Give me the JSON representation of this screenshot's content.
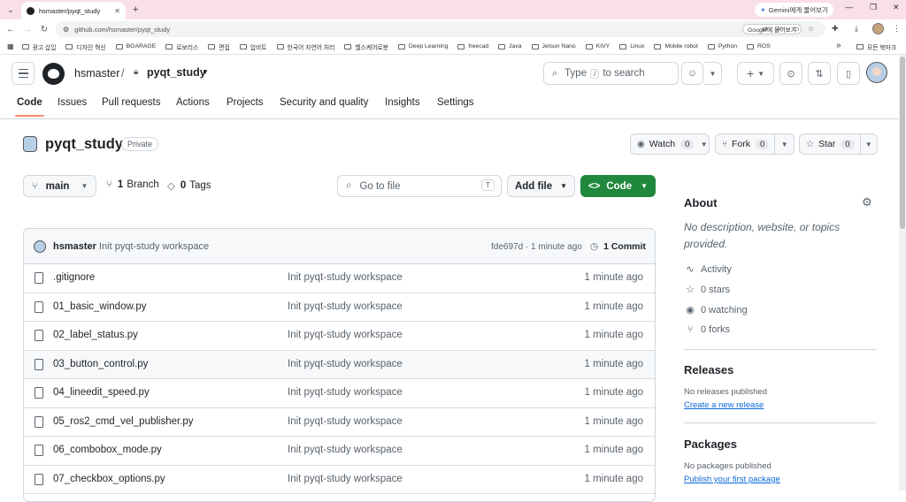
{
  "browser": {
    "tab_title": "hsmaster/pyqt_study",
    "url": "github.com/hsmaster/pyqt_study",
    "gemini": "Gemini에게 물어보기",
    "google_translate": "Google에 물어보기",
    "bookmarks": [
      "광고 삽입",
      "디자인 혁신",
      "BGARAGE",
      "로보리스",
      "면접",
      "업비트",
      "한국어 자연어 처리",
      "헬스케어로봇",
      "Deep Learning",
      "freecad",
      "Java",
      "Jetson Nano",
      "KIVY",
      "Linux",
      "Mobile robot",
      "Python",
      "ROS"
    ],
    "all_bookmarks": "모든 북마크"
  },
  "header": {
    "owner": "hsmaster",
    "separator": "/",
    "repo": "pyqt_study",
    "search_type": "Type",
    "search_key": "/",
    "search_rest": "to search"
  },
  "nav": {
    "tabs": [
      "Code",
      "Issues",
      "Pull requests",
      "Actions",
      "Projects",
      "Security and quality",
      "Insights",
      "Settings"
    ]
  },
  "repo": {
    "name": "pyqt_study",
    "visibility": "Private",
    "watch_label": "Watch",
    "watch_count": "0",
    "fork_label": "Fork",
    "fork_count": "0",
    "star_label": "Star",
    "star_count": "0"
  },
  "branch": {
    "current": "main",
    "branches_count": "1",
    "branches_label": "Branch",
    "tags_count": "0",
    "tags_label": "Tags",
    "goto_placeholder": "Go to file",
    "goto_key": "T",
    "add_file": "Add file",
    "code": "Code"
  },
  "commit": {
    "author": "hsmaster",
    "message": "Init pyqt-study workspace",
    "sha_time": "fde697d · 1 minute ago",
    "commits": "1 Commit"
  },
  "files": [
    {
      "name": ".gitignore",
      "msg": "Init pyqt-study workspace",
      "age": "1 minute ago"
    },
    {
      "name": "01_basic_window.py",
      "msg": "Init pyqt-study workspace",
      "age": "1 minute ago"
    },
    {
      "name": "02_label_status.py",
      "msg": "Init pyqt-study workspace",
      "age": "1 minute ago"
    },
    {
      "name": "03_button_control.py",
      "msg": "Init pyqt-study workspace",
      "age": "1 minute ago"
    },
    {
      "name": "04_lineedit_speed.py",
      "msg": "Init pyqt-study workspace",
      "age": "1 minute ago"
    },
    {
      "name": "05_ros2_cmd_vel_publisher.py",
      "msg": "Init pyqt-study workspace",
      "age": "1 minute ago"
    },
    {
      "name": "06_combobox_mode.py",
      "msg": "Init pyqt-study workspace",
      "age": "1 minute ago"
    },
    {
      "name": "07_checkbox_options.py",
      "msg": "Init pyqt-study workspace",
      "age": "1 minute ago"
    }
  ],
  "about": {
    "title": "About",
    "description": "No description, website, or topics provided.",
    "activity": "Activity",
    "stars": "0 stars",
    "watching": "0 watching",
    "forks": "0 forks"
  },
  "releases": {
    "title": "Releases",
    "text": "No releases published",
    "link": "Create a new release"
  },
  "packages": {
    "title": "Packages",
    "text": "No packages published",
    "link": "Publish your first package"
  },
  "colors": {
    "accent": "#1f883d",
    "tab_underline": "#fd8c73",
    "link": "#0969da",
    "tabstrip": "#f9dfe8"
  }
}
